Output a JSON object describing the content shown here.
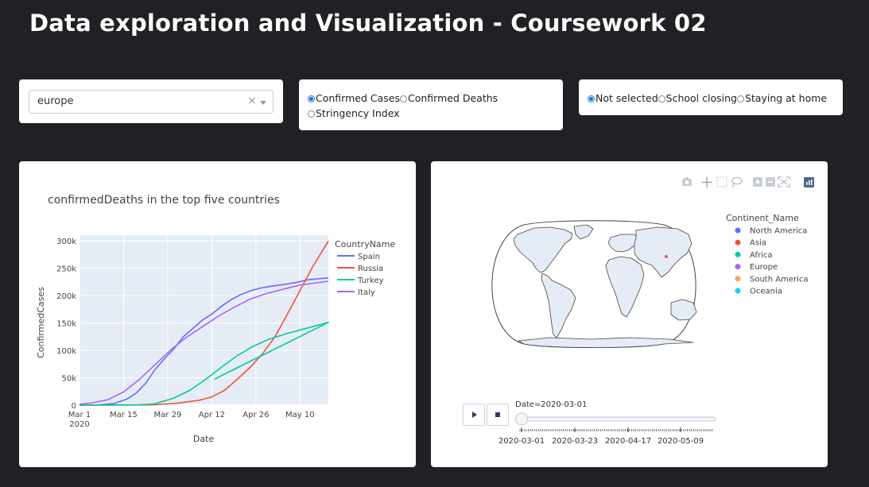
{
  "title": "Data exploration and Visualization - Coursework 02",
  "dropdown": {
    "value": "europe",
    "clear": "×"
  },
  "metric_radio": {
    "options": [
      {
        "label": "Confirmed Cases",
        "selected": true
      },
      {
        "label": "Confirmed Deaths",
        "selected": false
      },
      {
        "label": "Stringency Index",
        "selected": false
      }
    ]
  },
  "policy_radio": {
    "options": [
      {
        "label": "Not selected",
        "selected": true
      },
      {
        "label": "School closing",
        "selected": false
      },
      {
        "label": "Staying at home",
        "selected": false
      }
    ]
  },
  "line_chart": {
    "chart_data": {
      "type": "line",
      "title": "confirmedDeaths in the top five countries",
      "xlabel": "Date",
      "ylabel": "ConfirmedCases",
      "x_ticks": [
        "Mar 1\n2020",
        "Mar 15",
        "Mar 29",
        "Apr 12",
        "Apr 26",
        "May 10"
      ],
      "y_ticks": [
        "0",
        "50k",
        "100k",
        "150k",
        "200k",
        "250k",
        "300k"
      ],
      "ylim": [
        0,
        310000
      ],
      "xlim": [
        "2020-03-01",
        "2020-05-19"
      ],
      "legend_title": "CountryName",
      "legend_position": "right",
      "grid": true,
      "series": [
        {
          "name": "Spain",
          "color": "#636efa",
          "points": [
            [
              "2020-03-01",
              0
            ],
            [
              "2020-03-07",
              400
            ],
            [
              "2020-03-12",
              3000
            ],
            [
              "2020-03-16",
              11000
            ],
            [
              "2020-03-19",
              22000
            ],
            [
              "2020-03-22",
              40000
            ],
            [
              "2020-03-25",
              65000
            ],
            [
              "2020-03-28",
              85000
            ],
            [
              "2020-03-31",
              103000
            ],
            [
              "2020-04-03",
              125000
            ],
            [
              "2020-04-06",
              140000
            ],
            [
              "2020-04-09",
              155000
            ],
            [
              "2020-04-12",
              166000
            ],
            [
              "2020-04-15",
              180000
            ],
            [
              "2020-04-18",
              192000
            ],
            [
              "2020-04-21",
              201000
            ],
            [
              "2020-04-24",
              208000
            ],
            [
              "2020-04-27",
              213000
            ],
            [
              "2020-05-01",
              217000
            ],
            [
              "2020-05-05",
              220000
            ],
            [
              "2020-05-09",
              224000
            ],
            [
              "2020-05-13",
              229000
            ],
            [
              "2020-05-19",
              232000
            ]
          ]
        },
        {
          "name": "Russia",
          "color": "#ef553b",
          "points": [
            [
              "2020-03-01",
              0
            ],
            [
              "2020-03-15",
              100
            ],
            [
              "2020-03-25",
              700
            ],
            [
              "2020-04-01",
              3500
            ],
            [
              "2020-04-08",
              9000
            ],
            [
              "2020-04-12",
              15000
            ],
            [
              "2020-04-16",
              27000
            ],
            [
              "2020-04-20",
              47000
            ],
            [
              "2020-04-24",
              68000
            ],
            [
              "2020-04-28",
              93000
            ],
            [
              "2020-05-02",
              124000
            ],
            [
              "2020-05-06",
              166000
            ],
            [
              "2020-05-10",
              209000
            ],
            [
              "2020-05-14",
              252000
            ],
            [
              "2020-05-19",
              299000
            ]
          ]
        },
        {
          "name": "Turkey",
          "color": "#00cc96",
          "points": [
            [
              "2020-03-01",
              0
            ],
            [
              "2020-03-20",
              600
            ],
            [
              "2020-03-25",
              2500
            ],
            [
              "2020-03-31",
              13000
            ],
            [
              "2020-04-05",
              27000
            ],
            [
              "2020-04-10",
              47000
            ],
            [
              "2020-04-15",
              69000
            ],
            [
              "2020-04-20",
              90000
            ],
            [
              "2020-04-25",
              107000
            ],
            [
              "2020-04-30",
              120000
            ],
            [
              "2020-05-05",
              129000
            ],
            [
              "2020-05-10",
              137000
            ],
            [
              "2020-05-19",
              151000
            ],
            [
              "2020-04-13",
              48000
            ],
            [
              "2020-05-19",
              151000
            ]
          ]
        },
        {
          "name": "Italy",
          "color": "#ab63fa",
          "points": [
            [
              "2020-03-01",
              1700
            ],
            [
              "2020-03-05",
              4000
            ],
            [
              "2020-03-10",
              10000
            ],
            [
              "2020-03-15",
              24000
            ],
            [
              "2020-03-20",
              47000
            ],
            [
              "2020-03-25",
              74000
            ],
            [
              "2020-03-30",
              101000
            ],
            [
              "2020-04-04",
              124000
            ],
            [
              "2020-04-09",
              143000
            ],
            [
              "2020-04-14",
              162000
            ],
            [
              "2020-04-19",
              178000
            ],
            [
              "2020-04-24",
              193000
            ],
            [
              "2020-04-29",
              203000
            ],
            [
              "2020-05-05",
              212000
            ],
            [
              "2020-05-10",
              219000
            ],
            [
              "2020-05-19",
              226000
            ]
          ]
        }
      ]
    }
  },
  "map": {
    "legend_title": "Continent_Name",
    "legend": [
      {
        "name": "North America",
        "color": "#636efa"
      },
      {
        "name": "Asia",
        "color": "#ef553b"
      },
      {
        "name": "Africa",
        "color": "#00cc96"
      },
      {
        "name": "Europe",
        "color": "#ab63fa"
      },
      {
        "name": "South America",
        "color": "#ffa15a"
      },
      {
        "name": "Oceania",
        "color": "#19d3f3"
      }
    ],
    "slider_label": "Date=2020-03-01",
    "slider_ticks": [
      "2020-03-01",
      "2020-03-23",
      "2020-04-17",
      "2020-05-09"
    ],
    "slider_position": 0,
    "modebar_icons": [
      "camera-icon",
      "pan-icon",
      "box-select-icon",
      "lasso-icon",
      "zoom-in-icon",
      "zoom-out-icon",
      "reset-icon",
      "plotly-logo-icon"
    ]
  }
}
